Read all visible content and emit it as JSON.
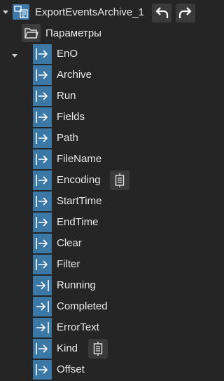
{
  "root": {
    "label": "ExportEventsArchive_1",
    "expanded": true,
    "icon": "function-block-icon",
    "undo_icon": "undo-icon",
    "redo_icon": "redo-icon"
  },
  "parameters_group": {
    "label": "Параметры",
    "expanded": true,
    "icon": "folder-icon"
  },
  "parameters": [
    {
      "label": "EnO",
      "icon": "input-pin-icon",
      "has_enum_button": false
    },
    {
      "label": "Archive",
      "icon": "input-pin-icon",
      "has_enum_button": false
    },
    {
      "label": "Run",
      "icon": "input-pin-icon",
      "has_enum_button": false
    },
    {
      "label": "Fields",
      "icon": "input-pin-icon",
      "has_enum_button": false
    },
    {
      "label": "Path",
      "icon": "input-pin-icon",
      "has_enum_button": false
    },
    {
      "label": "FileName",
      "icon": "input-pin-icon",
      "has_enum_button": false
    },
    {
      "label": "Encoding",
      "icon": "input-pin-icon",
      "has_enum_button": true
    },
    {
      "label": "StartTime",
      "icon": "input-pin-icon",
      "has_enum_button": false
    },
    {
      "label": "EndTime",
      "icon": "input-pin-icon",
      "has_enum_button": false
    },
    {
      "label": "Clear",
      "icon": "input-pin-icon",
      "has_enum_button": false
    },
    {
      "label": "Filter",
      "icon": "input-pin-icon",
      "has_enum_button": false
    },
    {
      "label": "Running",
      "icon": "output-pin-icon",
      "has_enum_button": false
    },
    {
      "label": "Completed",
      "icon": "output-pin-icon",
      "has_enum_button": false
    },
    {
      "label": "ErrorText",
      "icon": "output-pin-icon",
      "has_enum_button": false
    },
    {
      "label": "Kind",
      "icon": "input-pin-icon",
      "has_enum_button": true
    },
    {
      "label": "Offset",
      "icon": "input-pin-icon",
      "has_enum_button": false
    }
  ],
  "colors": {
    "background": "#252526",
    "pin_icon_bg": "#3b78a6",
    "text": "#e8e8e8",
    "button_bg": "#3a3a3b"
  }
}
